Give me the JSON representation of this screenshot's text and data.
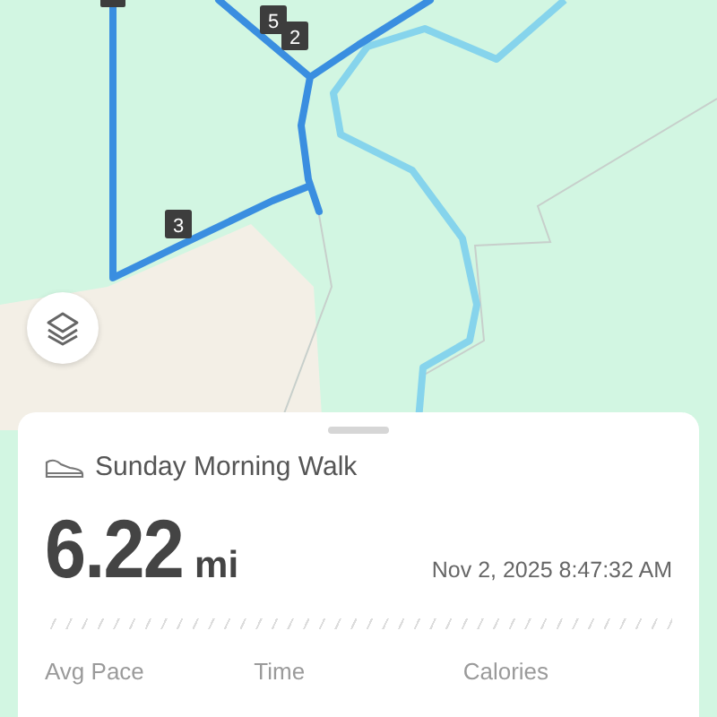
{
  "map": {
    "markers": [
      {
        "label": "5"
      },
      {
        "label": "2"
      },
      {
        "label": "3"
      }
    ]
  },
  "activity": {
    "title": "Sunday Morning Walk",
    "distance": "6.22",
    "unit": "mi",
    "date": "Nov 2, 2025 8:47:32 AM",
    "stats": [
      "Avg Pace",
      "Time",
      "Calories"
    ]
  }
}
